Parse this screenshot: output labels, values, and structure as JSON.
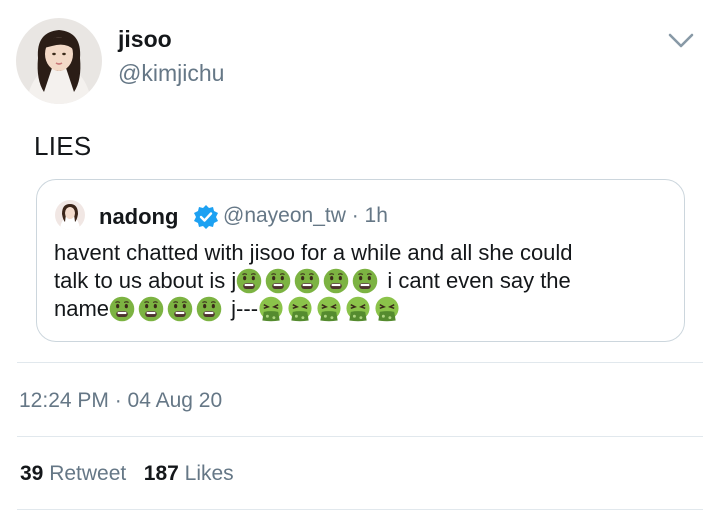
{
  "user": {
    "display_name": "jisoo",
    "handle": "@kimjichu",
    "avatar_icon": "profile-photo"
  },
  "tweet": {
    "text": "LIES"
  },
  "quoted_tweet": {
    "display_name": "nadong",
    "verified": true,
    "handle_meta": "@nayeon_tw · 1h",
    "line1": "havent chatted with jisoo for a while and all she could",
    "line2_prefix": "talk to us about is j",
    "line2_suffix": " i cant even say the",
    "line3_prefix": "name",
    "line3_mid": " j---",
    "emoji_nauseated": "nauseated-face-emoji",
    "emoji_vomiting": "face-vomiting-emoji"
  },
  "meta": {
    "timestamp": "12:24 PM · 04 Aug 20"
  },
  "stats": {
    "retweets_count": "39",
    "retweets_label": "Retweet",
    "likes_count": "187",
    "likes_label": "Likes"
  },
  "colors": {
    "text": "#14171a",
    "secondary": "#657786",
    "border": "#ccd6dd",
    "divider": "#e1e8ed",
    "verified_blue": "#1da1f2"
  }
}
